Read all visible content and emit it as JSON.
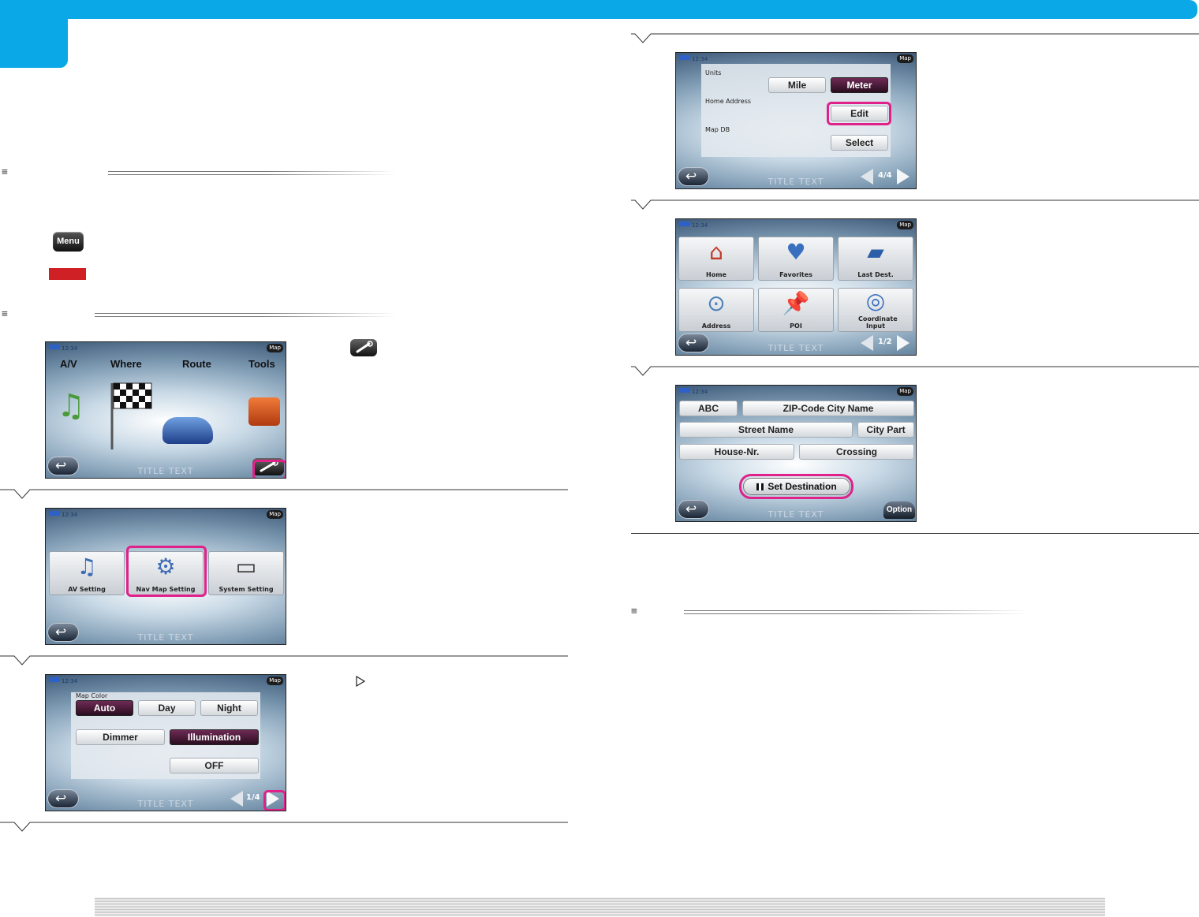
{
  "menu_key": {
    "label": "Menu"
  },
  "screen_common": {
    "clock": "12:34",
    "map_button": "Map",
    "title_text": "TITLE TEXT"
  },
  "screen1": {
    "tabs": [
      "A/V",
      "Where",
      "Route",
      "Tools"
    ]
  },
  "screen2": {
    "tiles": [
      "AV Setting",
      "Nav Map Setting",
      "System Setting"
    ]
  },
  "screen3": {
    "map_color_label": "Map Color",
    "auto": "Auto",
    "day": "Day",
    "night": "Night",
    "dimmer": "Dimmer",
    "illumination": "Illumination",
    "off": "OFF",
    "page": "1/4"
  },
  "screen4": {
    "units_label": "Units",
    "mile": "Mile",
    "meter": "Meter",
    "home_address_label": "Home Address",
    "edit": "Edit",
    "map_db_label": "Map DB",
    "select": "Select",
    "page": "4/4"
  },
  "screen5": {
    "tiles": [
      "Home",
      "Favorites",
      "Last Dest.",
      "Address",
      "POI",
      "Coordinate Input"
    ],
    "page": "1/2"
  },
  "screen6": {
    "abc": "ABC",
    "zip": "ZIP-Code City Name",
    "street": "Street Name",
    "city_part": "City Part",
    "house": "House-Nr.",
    "crossing": "Crossing",
    "set_destination": "Set Destination",
    "option": "Option"
  },
  "colors": {
    "accent": "#0aa8e6",
    "highlight": "#e0218a",
    "warning_red": "#cf2026"
  },
  "icons": {
    "section": "list-icon",
    "tools": "wrench-icon",
    "next": "play-right-icon"
  }
}
